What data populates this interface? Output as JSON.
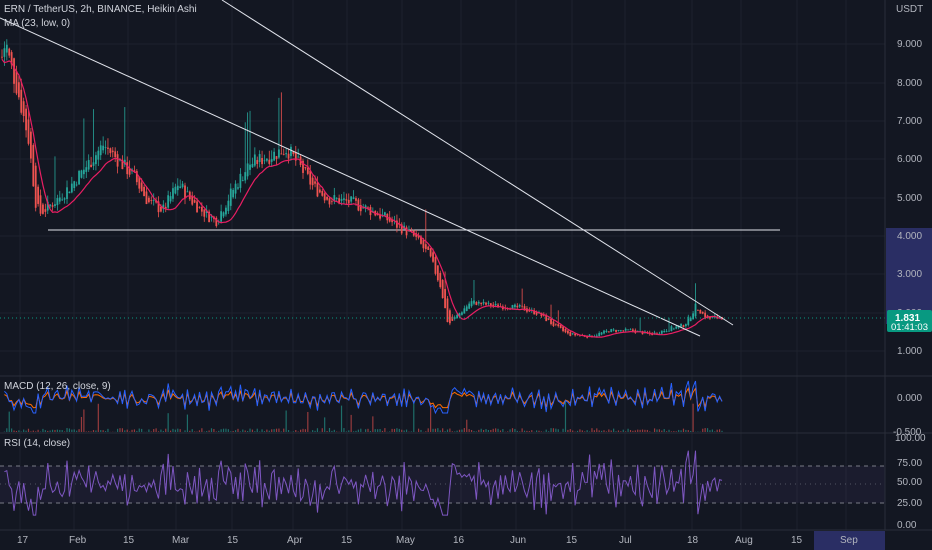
{
  "header": {
    "symbol_line": "ERN / TetherUS, 2h, BINANCE, Heikin Ashi",
    "ma_label": "MA (23, low, 0)"
  },
  "price_axis": {
    "currency": "USDT",
    "ticks": [
      "9.000",
      "8.000",
      "7.000",
      "6.000",
      "5.000",
      "4.000",
      "3.000",
      "2.000",
      "1.000"
    ],
    "highlight_tick": "4.000",
    "current_price": "1.831",
    "countdown": "01:41:03"
  },
  "macd": {
    "label": "MACD (12, 26, close, 9)",
    "ticks": [
      "0.000",
      "-0.500"
    ]
  },
  "rsi": {
    "label": "RSI (14, close)",
    "ticks": [
      "100.00",
      "75.00",
      "50.00",
      "25.00",
      "0.00"
    ]
  },
  "time_axis": {
    "labels": [
      "17",
      "Feb",
      "15",
      "Mar",
      "15",
      "Apr",
      "15",
      "May",
      "16",
      "Jun",
      "15",
      "Jul",
      "18",
      "Aug",
      "15",
      "Sep"
    ],
    "highlight_label": "Sep"
  },
  "colors": {
    "background": "#131722",
    "up": "#26a69a",
    "down": "#ef5350",
    "ma": "#e91e63",
    "macd": "#2962ff",
    "signal": "#ff6d00",
    "rsi": "#7e57c2",
    "current_price_badge": "#089981",
    "axis_highlight": "#2a2e64"
  },
  "chart_data": {
    "type": "candlestick",
    "title": "ERN / TetherUS, 2h, BINANCE, Heikin Ashi",
    "ylabel": "USDT",
    "ylim": [
      0.4,
      9.7
    ],
    "date_range": [
      "Jan 14",
      "Jul 25"
    ],
    "price_path": [
      {
        "date": "Jan 14",
        "price": 8.6
      },
      {
        "date": "Jan 15",
        "price": 9.0
      },
      {
        "date": "Jan 16",
        "price": 8.5
      },
      {
        "date": "Jan 18",
        "price": 7.8
      },
      {
        "date": "Jan 21",
        "price": 6.5
      },
      {
        "date": "Jan 23",
        "price": 4.8
      },
      {
        "date": "Jan 24",
        "price": 4.5
      },
      {
        "date": "Jan 29",
        "price": 4.9
      },
      {
        "date": "Feb 01",
        "price": 5.2
      },
      {
        "date": "Feb 06",
        "price": 5.8
      },
      {
        "date": "Feb 10",
        "price": 6.3
      },
      {
        "date": "Feb 14",
        "price": 5.9
      },
      {
        "date": "Feb 18",
        "price": 5.5
      },
      {
        "date": "Feb 22",
        "price": 4.8
      },
      {
        "date": "Feb 26",
        "price": 4.6
      },
      {
        "date": "Mar 02",
        "price": 5.3
      },
      {
        "date": "Mar 05",
        "price": 4.9
      },
      {
        "date": "Mar 08",
        "price": 4.6
      },
      {
        "date": "Mar 12",
        "price": 4.3
      },
      {
        "date": "Mar 17",
        "price": 5.2
      },
      {
        "date": "Mar 21",
        "price": 5.8
      },
      {
        "date": "Mar 26",
        "price": 6.0
      },
      {
        "date": "Mar 31",
        "price": 6.2
      },
      {
        "date": "Apr 03",
        "price": 5.8
      },
      {
        "date": "Apr 07",
        "price": 5.2
      },
      {
        "date": "Apr 11",
        "price": 4.9
      },
      {
        "date": "Apr 17",
        "price": 4.8
      },
      {
        "date": "Apr 22",
        "price": 4.6
      },
      {
        "date": "Apr 26",
        "price": 4.4
      },
      {
        "date": "May 01",
        "price": 4.1
      },
      {
        "date": "May 04",
        "price": 3.9
      },
      {
        "date": "May 08",
        "price": 3.4
      },
      {
        "date": "May 11",
        "price": 2.6
      },
      {
        "date": "May 13",
        "price": 1.6
      },
      {
        "date": "May 15",
        "price": 1.8
      },
      {
        "date": "May 19",
        "price": 2.2
      },
      {
        "date": "May 25",
        "price": 2.1
      },
      {
        "date": "Jun 01",
        "price": 2.05
      },
      {
        "date": "Jun 06",
        "price": 1.9
      },
      {
        "date": "Jun 10",
        "price": 1.6
      },
      {
        "date": "Jun 14",
        "price": 1.35
      },
      {
        "date": "Jun 20",
        "price": 1.3
      },
      {
        "date": "Jun 25",
        "price": 1.45
      },
      {
        "date": "Jul 01",
        "price": 1.45
      },
      {
        "date": "Jul 06",
        "price": 1.35
      },
      {
        "date": "Jul 11",
        "price": 1.5
      },
      {
        "date": "Jul 15",
        "price": 1.6
      },
      {
        "date": "Jul 17",
        "price": 1.9
      },
      {
        "date": "Jul 18",
        "price": 2.1
      },
      {
        "date": "Jul 21",
        "price": 1.75
      },
      {
        "date": "Jul 25",
        "price": 1.831
      }
    ],
    "trendlines": [
      {
        "type": "descending",
        "from": {
          "date": "Jan 14",
          "price": 9.3
        },
        "to": {
          "date": "Jul 19",
          "price": 1.4
        }
      },
      {
        "type": "descending",
        "from": {
          "date": "Feb 24",
          "price": 9.7
        },
        "to": {
          "date": "Jul 23",
          "price": 1.65
        }
      },
      {
        "type": "support",
        "from": {
          "date": "Jan 23",
          "price": 4.15
        },
        "to": {
          "date": "Jul 28",
          "price": 4.15
        }
      }
    ],
    "current_price": 1.831
  }
}
